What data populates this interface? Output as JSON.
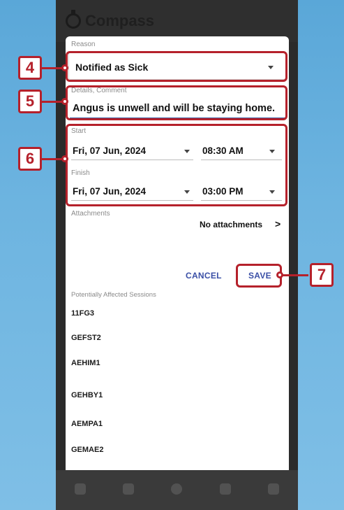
{
  "app": {
    "title": "Compass",
    "logo_icon": "compass-logo-icon"
  },
  "form": {
    "reason": {
      "label": "Reason",
      "value": "Notified as Sick"
    },
    "details": {
      "label": "Details, Comment",
      "value": "Angus is unwell and will be staying home."
    },
    "start": {
      "label": "Start",
      "date": "Fri, 07 Jun, 2024",
      "time": "08:30 AM"
    },
    "finish": {
      "label": "Finish",
      "date": "Fri, 07 Jun, 2024",
      "time": "03:00 PM"
    },
    "attachments": {
      "label": "Attachments",
      "value": "No attachments",
      "chevron": ">"
    }
  },
  "actions": {
    "cancel_label": "CANCEL",
    "save_label": "SAVE"
  },
  "sessions": {
    "title": "Potentially Affected Sessions",
    "items": [
      {
        "code": "11FG3"
      },
      {
        "code": "GEFST2"
      },
      {
        "code": "AEHIM1"
      },
      {
        "code": "GEHBY1"
      },
      {
        "code": "AEMPA1"
      },
      {
        "code": "GEMAE2"
      }
    ]
  },
  "callouts": {
    "c4": "4",
    "c5": "5",
    "c6": "6",
    "c7": "7",
    "color": "#b5212b"
  },
  "colors": {
    "accent": "#3a4fa6",
    "background": "#6db4e0"
  }
}
